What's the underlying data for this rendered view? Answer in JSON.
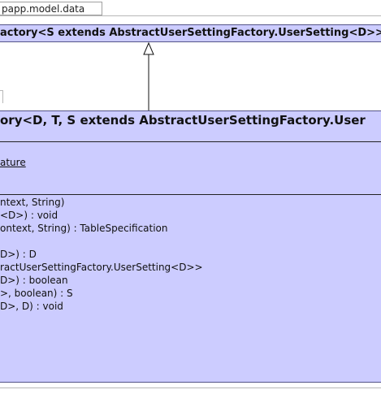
{
  "package": {
    "tab_label": "papp.model.data"
  },
  "superclass": {
    "title": "actory<S extends AbstractUserSettingFactory.UserSetting<D>>"
  },
  "class": {
    "title": "ory<D, T, S extends AbstractUserSettingFactory.User",
    "attributes": [
      "ature"
    ],
    "operations": [
      "ntext, String)",
      "<D>) : void",
      "ontext, String) : TableSpecification",
      "",
      "D>) : D",
      "ractUserSettingFactory.UserSetting<D>>",
      "D>) : boolean",
      ">, boolean) : S",
      "D>, D) : void"
    ]
  },
  "colors": {
    "class_fill": "#ccccff",
    "class_border": "#555588",
    "frame_border": "#b8b8b8"
  }
}
